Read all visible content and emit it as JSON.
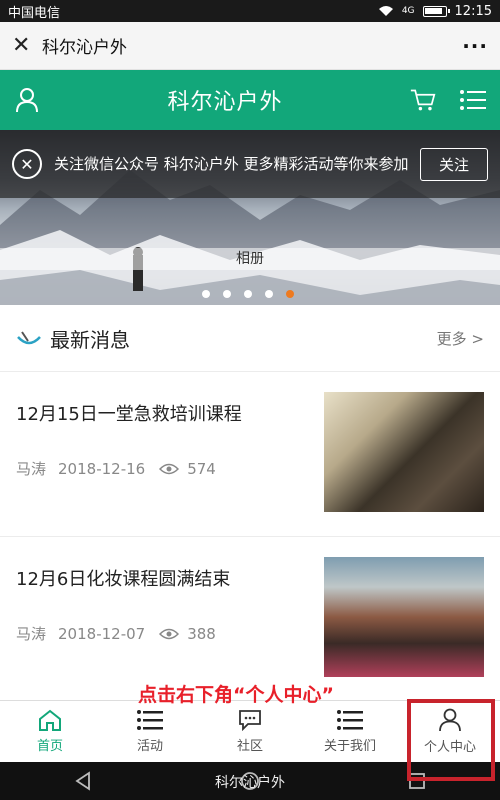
{
  "status_bar": {
    "carrier": "中国电信",
    "time": "12:15"
  },
  "title_bar": {
    "title": "科尔沁户外",
    "more": "···"
  },
  "header": {
    "title": "科尔沁户外"
  },
  "banner": {
    "follow_text": "关注微信公众号 科尔沁户外 更多精彩活动等你来参加",
    "follow_button": "关注",
    "album_label": "相册",
    "dots_total": 5,
    "dots_active_index": 4
  },
  "news": {
    "section_title": "最新消息",
    "more": "更多 >",
    "items": [
      {
        "title": "12月15日一堂急救培训课程",
        "author": "马涛",
        "date": "2018-12-16",
        "views": "574"
      },
      {
        "title": "12月6日化妆课程圆满结束",
        "author": "马涛",
        "date": "2018-12-07",
        "views": "388"
      }
    ]
  },
  "annotation": {
    "text": "点击右下角“个人中心”"
  },
  "tabs": [
    {
      "label": "首页",
      "icon": "home-icon",
      "active": true
    },
    {
      "label": "活动",
      "icon": "list-icon",
      "active": false
    },
    {
      "label": "社区",
      "icon": "chat-icon",
      "active": false
    },
    {
      "label": "关于我们",
      "icon": "list-icon",
      "active": false
    },
    {
      "label": "个人中心",
      "icon": "user-icon",
      "active": false
    }
  ],
  "nav_caption": "科尔沁户外",
  "colors": {
    "brand": "#12a77a",
    "dot_active": "#ee7a1f",
    "annotation": "#e8202a"
  }
}
